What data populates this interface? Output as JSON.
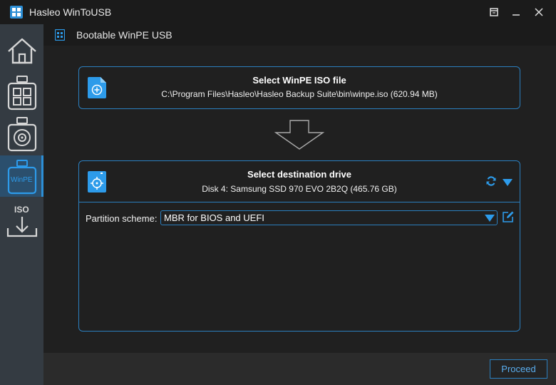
{
  "window": {
    "title": "Hasleo WinToUSB"
  },
  "sidebar": {
    "items": [
      {
        "name": "home",
        "label": ""
      },
      {
        "name": "windows-to-usb",
        "label": ""
      },
      {
        "name": "disk-to-usb",
        "label": ""
      },
      {
        "name": "winpe",
        "label": "WinPE",
        "active": true
      },
      {
        "name": "iso",
        "label": "ISO"
      }
    ]
  },
  "header": {
    "title": "Bootable WinPE USB"
  },
  "iso": {
    "title": "Select WinPE ISO file",
    "path": "C:\\Program Files\\Hasleo\\Hasleo Backup Suite\\bin\\winpe.iso (620.94 MB)"
  },
  "destination": {
    "title": "Select destination drive",
    "drive": "Disk 4: Samsung SSD 970 EVO 2B2Q (465.76 GB)"
  },
  "partition": {
    "label": "Partition scheme:",
    "value": "MBR for BIOS and UEFI"
  },
  "footer": {
    "proceed_label": "Proceed"
  },
  "colors": {
    "accent": "#2b7fbf",
    "accent_light": "#2d9bea",
    "background": "#202020"
  }
}
